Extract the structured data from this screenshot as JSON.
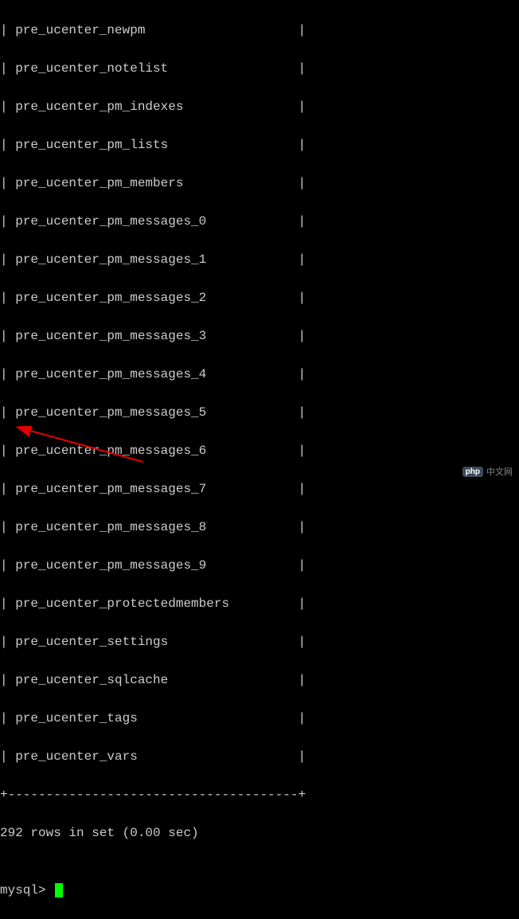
{
  "terminal": {
    "rows": [
      "| pre_ucenter_newpm                    |",
      "| pre_ucenter_notelist                 |",
      "| pre_ucenter_pm_indexes               |",
      "| pre_ucenter_pm_lists                 |",
      "| pre_ucenter_pm_members               |",
      "| pre_ucenter_pm_messages_0            |",
      "| pre_ucenter_pm_messages_1            |",
      "| pre_ucenter_pm_messages_2            |",
      "| pre_ucenter_pm_messages_3            |",
      "| pre_ucenter_pm_messages_4            |",
      "| pre_ucenter_pm_messages_5            |",
      "| pre_ucenter_pm_messages_6            |",
      "| pre_ucenter_pm_messages_7            |",
      "| pre_ucenter_pm_messages_8            |",
      "| pre_ucenter_pm_messages_9            |",
      "| pre_ucenter_protectedmembers         |",
      "| pre_ucenter_settings                 |",
      "| pre_ucenter_sqlcache                 |",
      "| pre_ucenter_tags                     |",
      "| pre_ucenter_vars                     |"
    ],
    "border": "+--------------------------------------+",
    "status": "292 rows in set (0.00 sec)",
    "blank": "",
    "prompt": "mysql> "
  },
  "watermark": {
    "logo": "php",
    "text": "中文网"
  }
}
